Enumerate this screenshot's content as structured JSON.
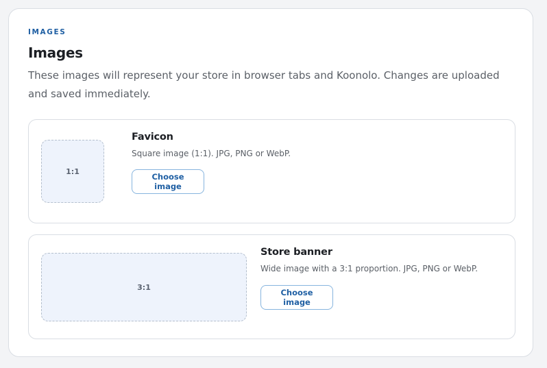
{
  "section": {
    "eyebrow": "IMAGES",
    "title": "Images",
    "description": "These images will represent your store in browser tabs and Koonolo. Changes are uploaded and saved immediately."
  },
  "favicon": {
    "ratio_label": "1:1",
    "title": "Favicon",
    "subtitle": "Square image (1:1). JPG, PNG or WebP.",
    "button_label": "Choose image"
  },
  "banner": {
    "ratio_label": "3:1",
    "title": "Store banner",
    "subtitle": "Wide image with a 3:1 proportion. JPG, PNG or WebP.",
    "button_label": "Choose image"
  },
  "colors": {
    "accent": "#1f5fa3",
    "preview_fill": "#eef3fc",
    "border": "#d9dde3"
  }
}
